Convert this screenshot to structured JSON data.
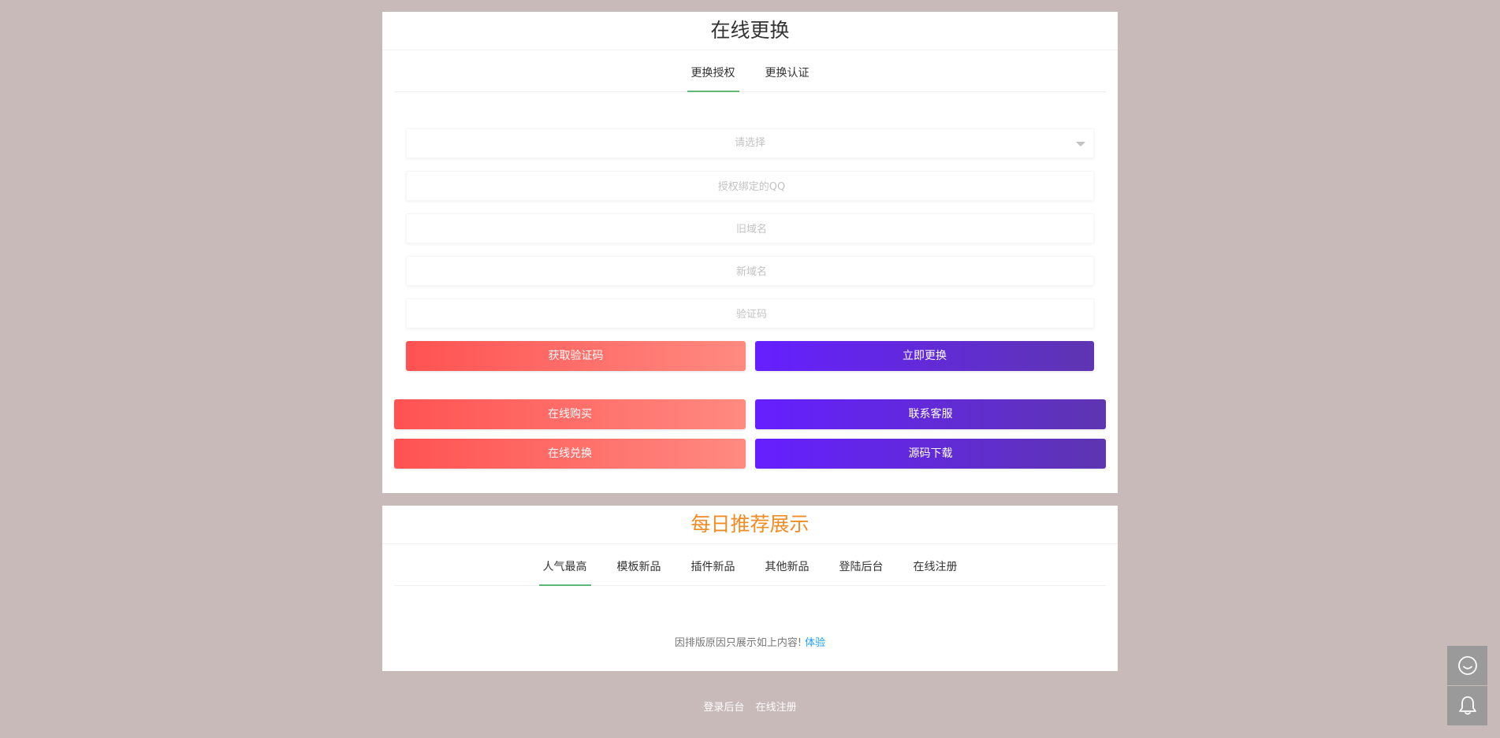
{
  "change_panel": {
    "title": "在线更换",
    "tabs": [
      {
        "label": "更换授权",
        "active": true
      },
      {
        "label": "更换认证",
        "active": false
      }
    ],
    "select": {
      "placeholder": "请选择"
    },
    "fields": {
      "qq_placeholder": "授权绑定的QQ",
      "old_domain_placeholder": "旧域名",
      "new_domain_placeholder": "新域名",
      "captcha_placeholder": "验证码"
    },
    "buttons": {
      "get_code": "获取验证码",
      "change_now": "立即更换",
      "buy_online": "在线购买",
      "contact_service": "联系客服",
      "redeem_online": "在线兑换",
      "source_download": "源码下载"
    }
  },
  "daily_panel": {
    "title": "每日推荐展示",
    "tabs": [
      {
        "label": "人气最高",
        "active": true
      },
      {
        "label": "模板新品",
        "active": false
      },
      {
        "label": "插件新品",
        "active": false
      },
      {
        "label": "其他新品",
        "active": false
      },
      {
        "label": "登陆后台",
        "active": false
      },
      {
        "label": "在线注册",
        "active": false
      }
    ],
    "notice_text": "因排版原因只展示如上内容!",
    "notice_link": "体验"
  },
  "footer": {
    "links": [
      "登录后台",
      "在线注册"
    ]
  },
  "floating": {
    "chat_icon": "chat-bubble-icon",
    "bell_icon": "bell-icon"
  },
  "colors": {
    "background": "#c8bab8",
    "tab_active_underline": "#5fb878",
    "red_gradient_start": "#ff5252",
    "red_gradient_end": "#ff8a80",
    "purple_gradient_start": "#651fff",
    "purple_gradient_end": "#5e35b1",
    "daily_title": "#f08c24",
    "link": "#1e9fff"
  }
}
